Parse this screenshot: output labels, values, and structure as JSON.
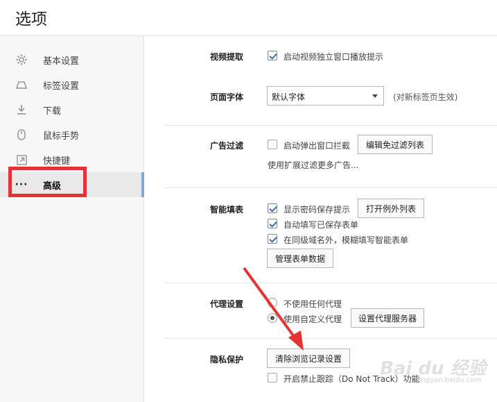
{
  "window": {
    "title": "选项"
  },
  "sidebar": {
    "items": [
      {
        "label": "基本设置",
        "icon": "gear-icon"
      },
      {
        "label": "标签设置",
        "icon": "tab-icon"
      },
      {
        "label": "下载",
        "icon": "download-icon"
      },
      {
        "label": "鼠标手势",
        "icon": "mouse-icon"
      },
      {
        "label": "快捷键",
        "icon": "shortcut-icon"
      },
      {
        "label": "高级",
        "icon": "more-icon",
        "active": true
      }
    ],
    "active_icon_text": "···"
  },
  "sections": {
    "video": {
      "label": "视频提取",
      "option": "启动视频独立窗口播放提示",
      "checked": true
    },
    "font": {
      "label": "页面字体",
      "select_value": "默认字体",
      "hint": "(对新标签页生效)"
    },
    "adblock": {
      "label": "广告过滤",
      "option": "启动弹出窗口拦截",
      "checked": false,
      "button": "编辑免过滤列表",
      "link": "使用扩展过滤更多广告..."
    },
    "autofill": {
      "label": "智能填表",
      "options": [
        {
          "text": "显示密码保存提示",
          "checked": true
        },
        {
          "text": "自动填写已保存表单",
          "checked": true
        },
        {
          "text": "在同级域名外，模糊填写智能表单",
          "checked": true
        }
      ],
      "exception_button": "打开例外列表",
      "manage_button": "管理表单数据"
    },
    "proxy": {
      "label": "代理设置",
      "options": [
        {
          "text": "不使用任何代理",
          "selected": false
        },
        {
          "text": "使用自定义代理",
          "selected": true
        }
      ],
      "button": "设置代理服务器"
    },
    "privacy": {
      "label": "隐私保护",
      "button": "清除浏览记录设置",
      "option": "开启禁止跟踪（Do Not Track）功能",
      "checked": false
    }
  },
  "annotation": {
    "color": "#e53333"
  },
  "watermark": {
    "text": "Bai du 经验",
    "sub": "jingyan.baidu.com"
  }
}
